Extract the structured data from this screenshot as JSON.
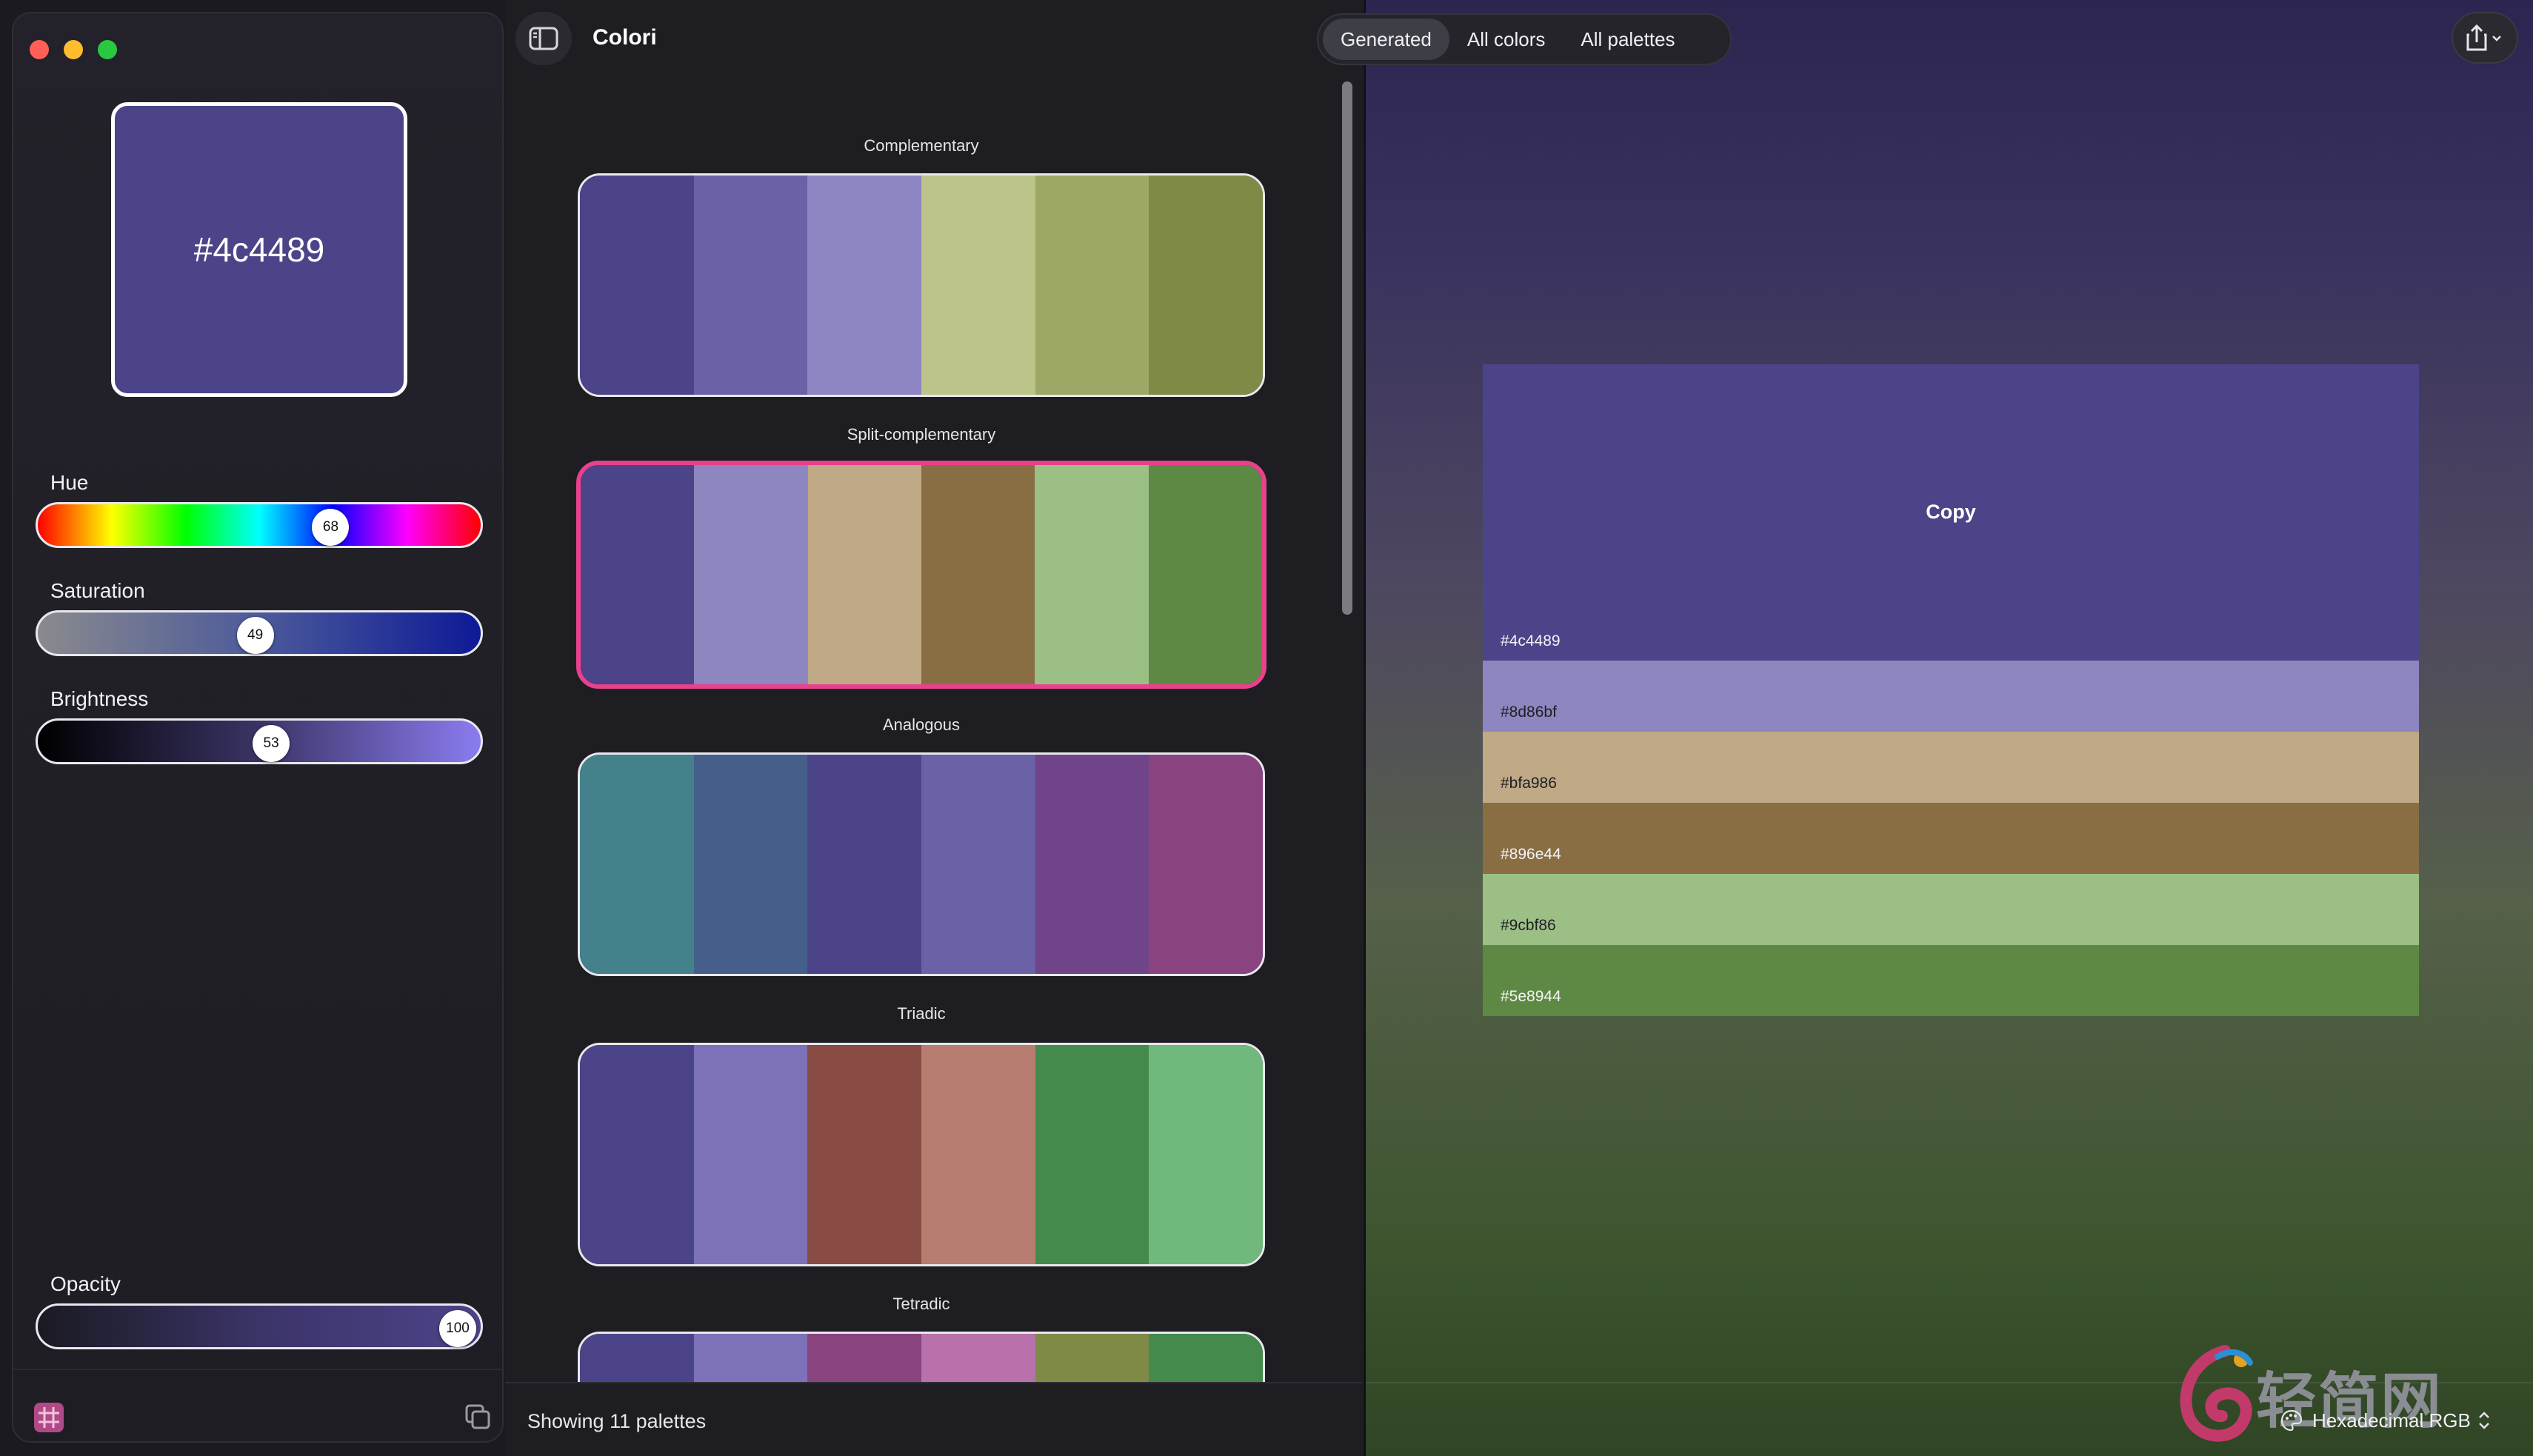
{
  "window": {
    "app_title": "Colori"
  },
  "editor": {
    "current_hex": "#4c4489",
    "sliders": {
      "hue": {
        "label": "Hue",
        "value": "68",
        "fraction": 0.68
      },
      "saturation": {
        "label": "Saturation",
        "value": "49",
        "fraction": 0.49
      },
      "brightness": {
        "label": "Brightness",
        "value": "53",
        "fraction": 0.53
      },
      "opacity": {
        "label": "Opacity",
        "value": "100",
        "fraction": 1.0
      }
    }
  },
  "tabs": [
    {
      "label": "Generated",
      "active": true
    },
    {
      "label": "All colors",
      "active": false
    },
    {
      "label": "All palettes",
      "active": false
    }
  ],
  "palettes": [
    {
      "title": "Complementary",
      "selected": false,
      "colors": [
        "#4c4489",
        "#6a61a6",
        "#8d86c2",
        "#bcc489",
        "#9da866",
        "#7f8a47"
      ]
    },
    {
      "title": "Split-complementary",
      "selected": true,
      "colors": [
        "#4c4489",
        "#8d86bf",
        "#bfa986",
        "#896e44",
        "#9cbf86",
        "#5e8944"
      ]
    },
    {
      "title": "Analogous",
      "selected": false,
      "colors": [
        "#44818a",
        "#465f8a",
        "#4c4489",
        "#6a61a6",
        "#704489",
        "#894480"
      ]
    },
    {
      "title": "Triadic",
      "selected": false,
      "colors": [
        "#4c4489",
        "#7d71b8",
        "#894c44",
        "#b87d71",
        "#448a4c",
        "#71b87d"
      ]
    },
    {
      "title": "Tetradic",
      "selected": false,
      "colors": [
        "#4c4489",
        "#7d71b8",
        "#894480",
        "#b871ab",
        "#7f8a47",
        "#448a4c"
      ]
    }
  ],
  "palette_count_text": "Showing 11 palettes",
  "detail": {
    "copy_label": "Copy",
    "colors": [
      {
        "hex": "#4c4489",
        "fill": "#4c4489",
        "dark_text": false
      },
      {
        "hex": "#8d86bf",
        "fill": "#8d86bf",
        "dark_text": true
      },
      {
        "hex": "#bfa986",
        "fill": "#bfa986",
        "dark_text": true
      },
      {
        "hex": "#896e44",
        "fill": "#896e44",
        "dark_text": false
      },
      {
        "hex": "#9cbf86",
        "fill": "#9cbf86",
        "dark_text": true
      },
      {
        "hex": "#5e8944",
        "fill": "#5e8944",
        "dark_text": false
      }
    ]
  },
  "format_selector": {
    "label": "Hexadecimal RGB",
    "icon": "palette-icon"
  },
  "watermark": {
    "text": "轻简网",
    "icon": "swirl-logo-icon"
  },
  "icons": {
    "sidebar_toggle": "sidebar-icon",
    "share": "share-icon",
    "grid": "hashtag-grid-icon",
    "copy_stack": "copy-stack-icon"
  }
}
